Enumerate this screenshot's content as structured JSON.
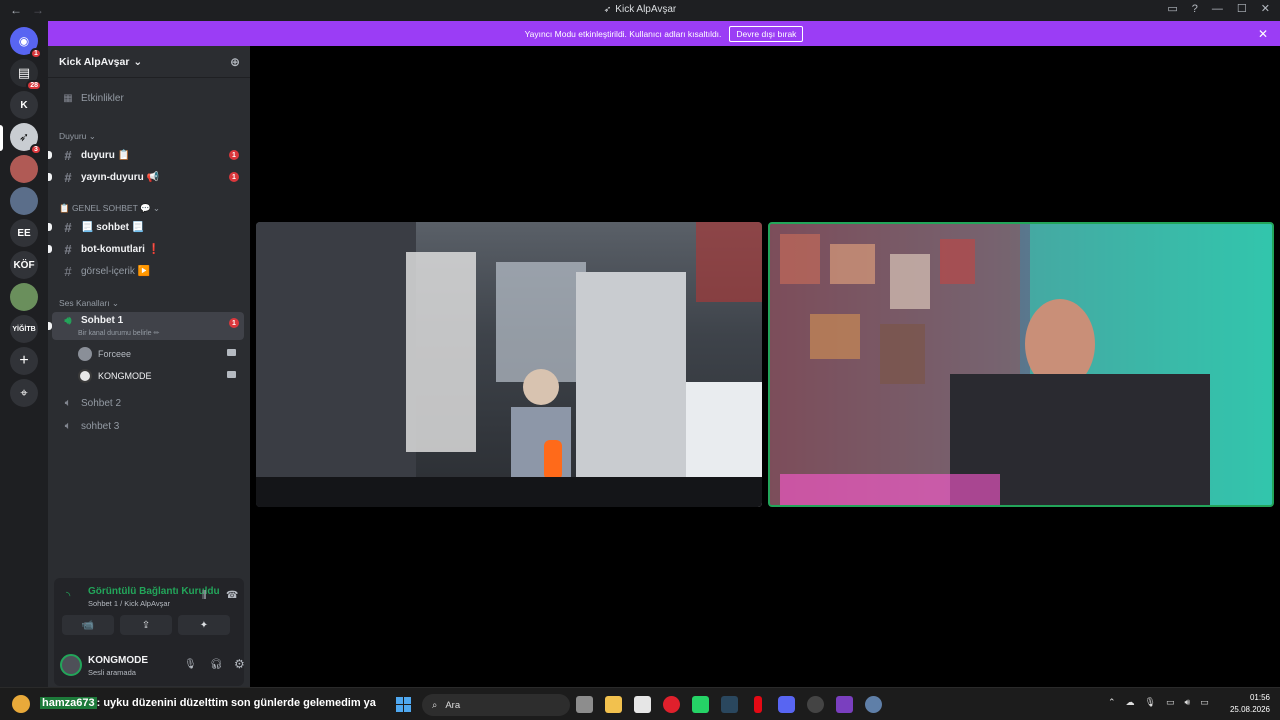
{
  "window": {
    "title": "Kick AlpAvşar",
    "back": "←",
    "forward": "→",
    "controls": [
      "▭",
      "?",
      "—",
      "☐",
      "✕"
    ]
  },
  "servers": [
    {
      "label": "",
      "icon": "discord-icon",
      "badge": "1"
    },
    {
      "label": "",
      "icon": "server-icon",
      "badge": "28"
    },
    {
      "label": "K",
      "icon": "",
      "badge": ""
    },
    {
      "label": "",
      "icon": "avatar-server",
      "badge": "3"
    },
    {
      "label": "",
      "icon": "avatar-server",
      "badge": ""
    },
    {
      "label": "",
      "icon": "avatar-server",
      "badge": ""
    },
    {
      "label": "EE",
      "icon": "",
      "badge": ""
    },
    {
      "label": "KÖF",
      "icon": "",
      "badge": ""
    },
    {
      "label": "",
      "icon": "avatar-server",
      "badge": ""
    },
    {
      "label": "YİĞİTB",
      "icon": "",
      "badge": ""
    },
    {
      "label": "+",
      "icon": "add-server-icon",
      "badge": ""
    },
    {
      "label": "⌖",
      "icon": "discover-icon",
      "badge": ""
    }
  ],
  "banner": {
    "text": "Yayıncı Modu etkinleştirildi. Kullanıcı adları kısaltıldı.",
    "button": "Devre dışı bırak",
    "close": "✕"
  },
  "sidebar": {
    "server_name": "Kick AlpAvşar",
    "chevron": "⌄",
    "events": "Etkinlikler",
    "categories": {
      "duyuru": "Duyuru ⌄",
      "genel": "📋 GENEL SOHBET 💬 ⌄",
      "ses": "Ses Kanalları ⌄"
    },
    "channels": [
      {
        "name": "duyuru 📋",
        "mention": "1"
      },
      {
        "name": "yayın-duyuru 📢",
        "mention": "1"
      },
      {
        "name": "📃 sohbet 📃",
        "mention": ""
      },
      {
        "name": "bot-komutlari ❗",
        "mention": ""
      },
      {
        "name": "görsel-içerik ▶️",
        "mention": ""
      }
    ],
    "voice_channels": [
      {
        "name": "Sohbet 1",
        "status": "Bir kanal durumu belirle ✏",
        "mention": "1"
      },
      {
        "name": "Sohbet 2"
      },
      {
        "name": "sohbet 3"
      }
    ],
    "voice_users": [
      "Forceee",
      "KONGMODE"
    ]
  },
  "voice_panel": {
    "status": "Görüntülü Bağlantı Kuruldu",
    "location": "Sohbet 1 / Kick AlpAvşar",
    "buttons": [
      "📹",
      "⇪",
      "✦",
      "✺"
    ],
    "user_name": "KONGMODE",
    "user_status": "Sesli aramada"
  },
  "taskbar": {
    "chat_user": "hamza673",
    "chat_text": ": uyku düzenini düzelttim son günlerde gelemedim ya",
    "search": "Ara",
    "time": "01:56",
    "date": "25.08.2026"
  },
  "colors": {
    "accent": "#9b3df5",
    "online": "#23a55a",
    "mention": "#da373c"
  }
}
